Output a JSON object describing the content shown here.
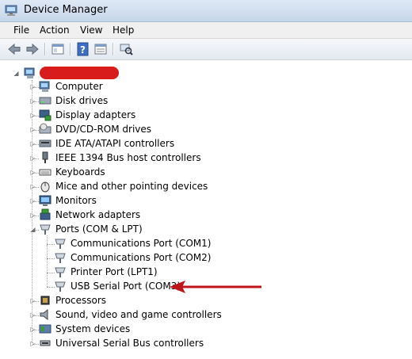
{
  "window": {
    "title": "Device Manager"
  },
  "menu": {
    "file": "File",
    "action": "Action",
    "view": "View",
    "help": "Help"
  },
  "toolbar": {
    "back_icon": "back-arrow-icon",
    "forward_icon": "forward-arrow-icon",
    "show_hide_icon": "console-tree-icon",
    "help_icon": "help-icon",
    "properties_icon": "properties-icon",
    "scan_icon": "scan-hardware-icon"
  },
  "tree": {
    "root_label": "",
    "categories": [
      {
        "label": "Computer",
        "icon": "computer-icon"
      },
      {
        "label": "Disk drives",
        "icon": "disk-drive-icon"
      },
      {
        "label": "Display adapters",
        "icon": "display-adapter-icon"
      },
      {
        "label": "DVD/CD-ROM drives",
        "icon": "dvd-drive-icon"
      },
      {
        "label": "IDE ATA/ATAPI controllers",
        "icon": "ide-controller-icon"
      },
      {
        "label": "IEEE 1394 Bus host controllers",
        "icon": "firewire-icon"
      },
      {
        "label": "Keyboards",
        "icon": "keyboard-icon"
      },
      {
        "label": "Mice and other pointing devices",
        "icon": "mouse-icon"
      },
      {
        "label": "Monitors",
        "icon": "monitor-icon"
      },
      {
        "label": "Network adapters",
        "icon": "network-adapter-icon"
      },
      {
        "label": "Ports (COM & LPT)",
        "icon": "port-icon",
        "expanded": true,
        "children": [
          {
            "label": "Communications Port (COM1)",
            "icon": "port-icon"
          },
          {
            "label": "Communications Port (COM2)",
            "icon": "port-icon"
          },
          {
            "label": "Printer Port (LPT1)",
            "icon": "port-icon"
          },
          {
            "label": "USB Serial Port (COM3)",
            "icon": "port-icon",
            "highlighted": true
          }
        ]
      },
      {
        "label": "Processors",
        "icon": "processor-icon"
      },
      {
        "label": "Sound, video and game controllers",
        "icon": "speaker-icon"
      },
      {
        "label": "System devices",
        "icon": "system-device-icon"
      },
      {
        "label": "Universal Serial Bus controllers",
        "icon": "usb-icon"
      }
    ]
  },
  "annotation": {
    "arrow_color": "#c0141c",
    "redaction_color": "#d81b1b"
  }
}
